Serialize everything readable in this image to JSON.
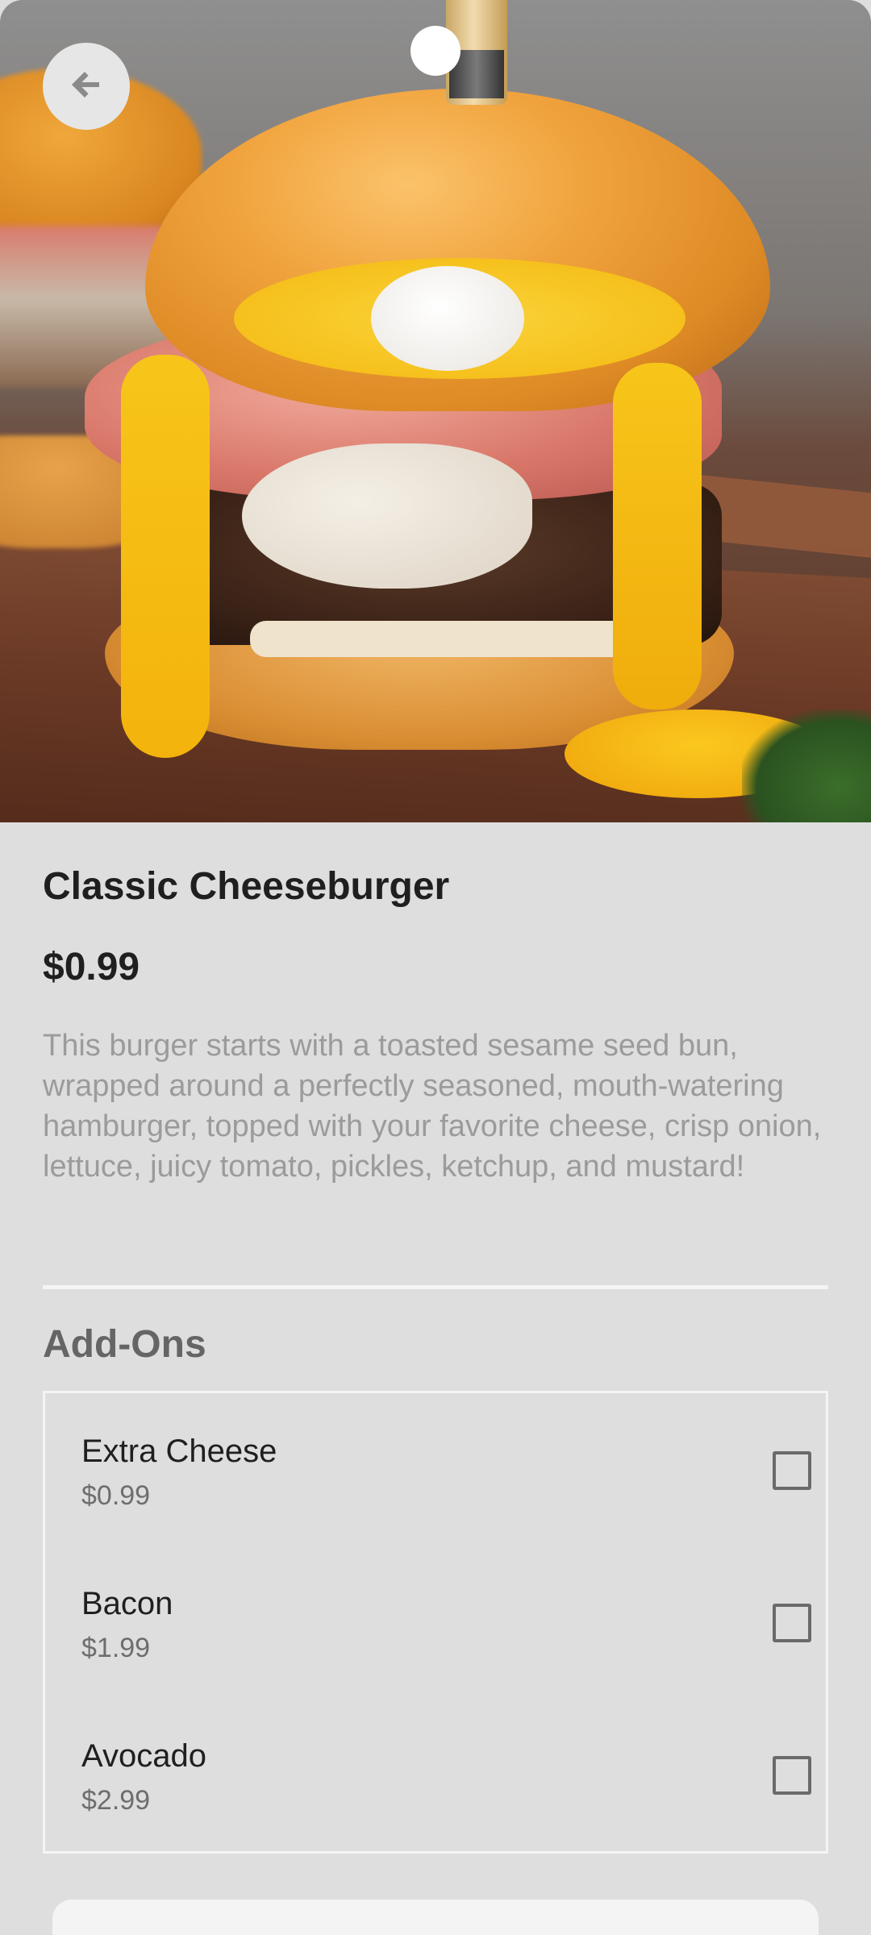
{
  "header": {
    "back_icon": "arrow-back-icon"
  },
  "product": {
    "name": "Classic Cheeseburger",
    "price": "$0.99",
    "description": "This burger starts with a toasted sesame seed bun, wrapped around a perfectly seasoned, mouth-watering hamburger, topped with your favorite cheese, crisp onion, lettuce, juicy tomato, pickles, ketchup, and mustard!"
  },
  "addons": {
    "title": "Add-Ons",
    "items": [
      {
        "name": "Extra Cheese",
        "price": "$0.99",
        "checked": false
      },
      {
        "name": "Bacon",
        "price": "$1.99",
        "checked": false
      },
      {
        "name": "Avocado",
        "price": "$2.99",
        "checked": false
      }
    ]
  },
  "colors": {
    "background": "#dedede",
    "title_text": "#1f1f1f",
    "description_text": "#9b9b9b",
    "section_title": "#656565"
  }
}
